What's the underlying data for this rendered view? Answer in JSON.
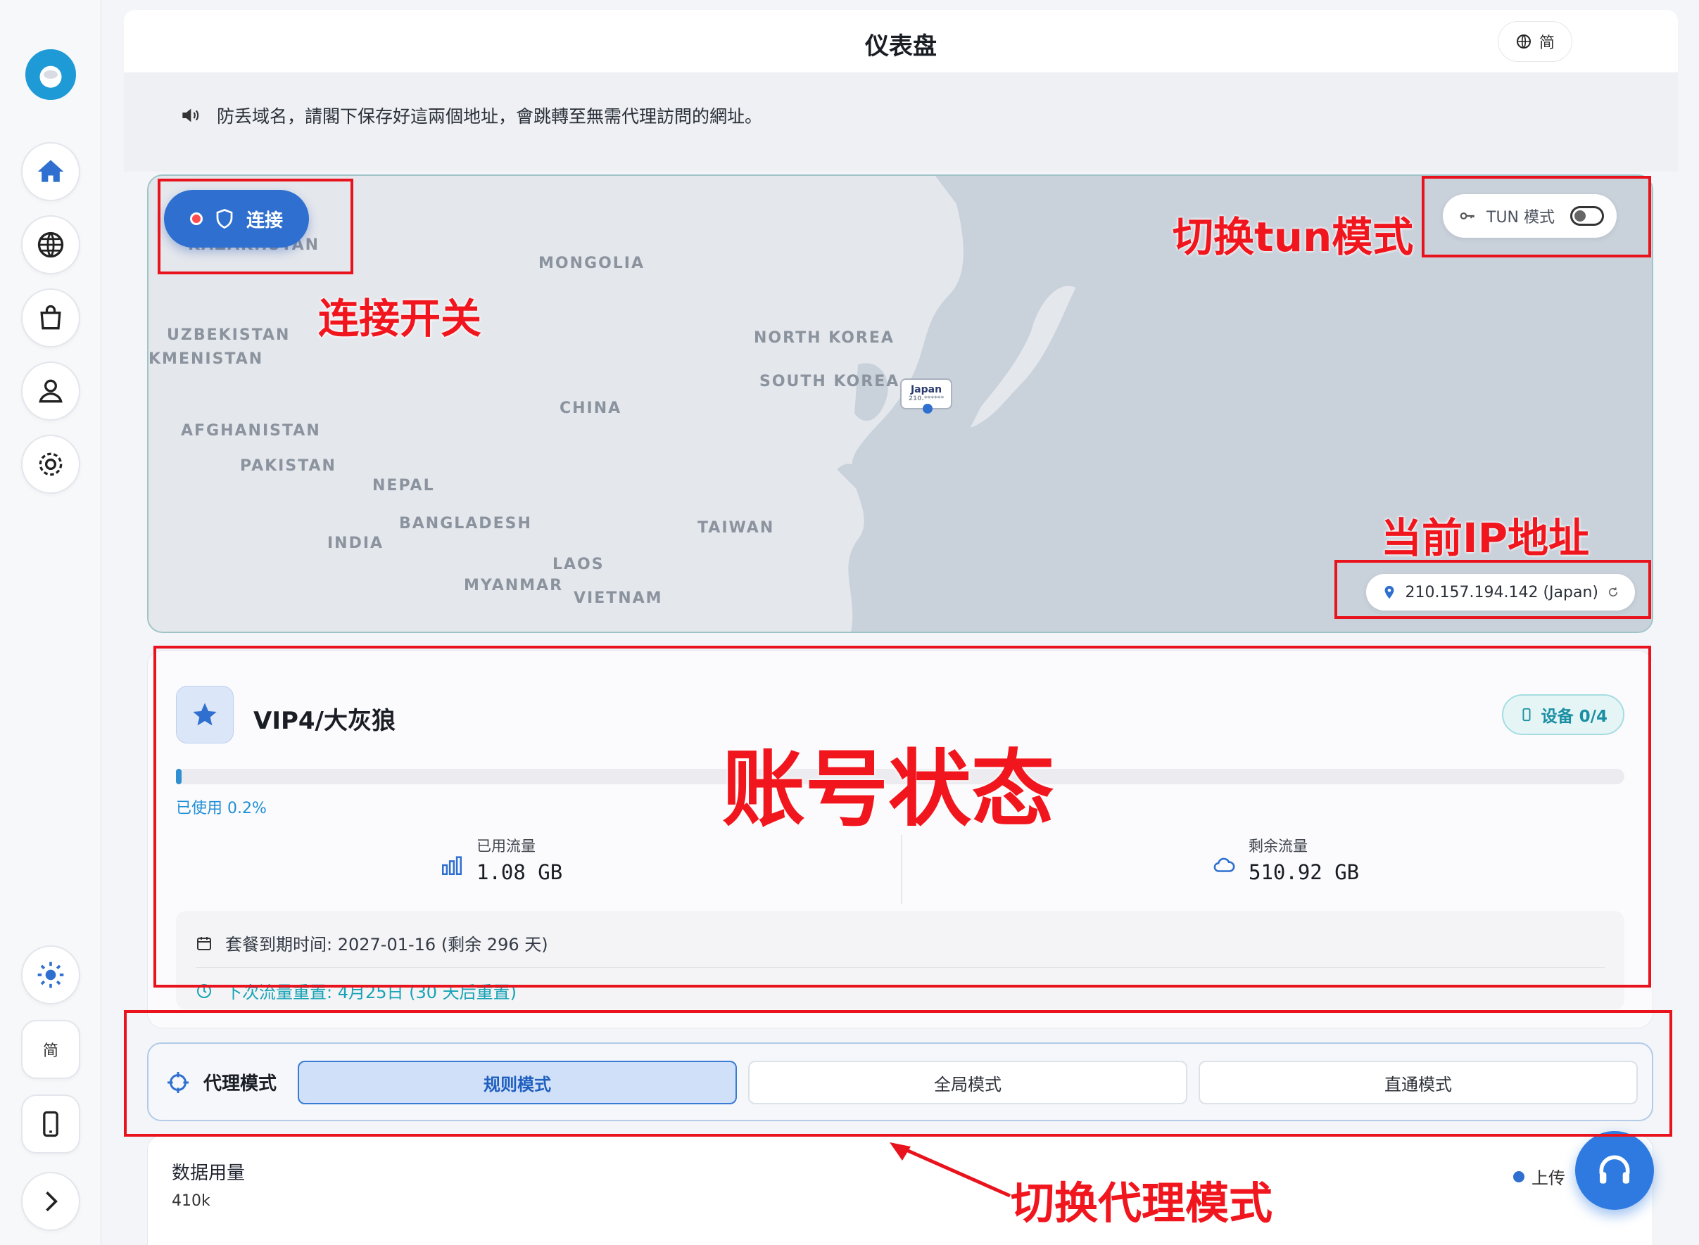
{
  "app": {
    "title": "仪表盘",
    "language_pill": "简"
  },
  "notice": {
    "text": "防丢域名，請閣下保存好這兩個地址，會跳轉至無需代理訪問的網址。"
  },
  "map": {
    "connect_label": "连接",
    "tun_label": "TUN 模式",
    "tun_enabled": false,
    "ip_address": "210.157.194.142 (Japan)",
    "marker_label": "Japan",
    "marker_sub": "210.******",
    "labels": [
      "KAZAKHSTAN",
      "MONGOLIA",
      "UZBEKISTAN",
      "KMENISTAN",
      "NORTH KOREA",
      "SOUTH KOREA",
      "CHINA",
      "AFGHANISTAN",
      "PAKISTAN",
      "NEPAL",
      "BANGLADESH",
      "INDIA",
      "TAIWAN",
      "LAOS",
      "MYANMAR",
      "VIETNAM"
    ]
  },
  "account": {
    "plan": "VIP4/大灰狼",
    "devices": "设备 0/4",
    "usage_pct_label": "已使用 0.2%",
    "usage_fraction": 0.002,
    "used_label": "已用流量",
    "used_value": "1.08 GB",
    "remain_label": "剩余流量",
    "remain_value": "510.92 GB",
    "expire": "套餐到期时间: 2027-01-16 (剩余 296 天)",
    "reset": "下次流量重置: 4月25日 (30 天后重置)"
  },
  "proxy": {
    "title": "代理模式",
    "modes": [
      "规则模式",
      "全局模式",
      "直通模式"
    ],
    "active": "规则模式"
  },
  "data_usage": {
    "title": "数据用量",
    "axis_top": "410k",
    "legend_upload": "上传"
  },
  "sidebar": {
    "lang_button": "简"
  },
  "annotations": {
    "connect": "连接开关",
    "tun": "切换tun模式",
    "ip": "当前IP地址",
    "account": "账号状态",
    "proxy": "切换代理模式"
  },
  "colors": {
    "accent": "#2f6fcf",
    "annotation": "#e8131c",
    "cyan": "#17a3b5"
  }
}
